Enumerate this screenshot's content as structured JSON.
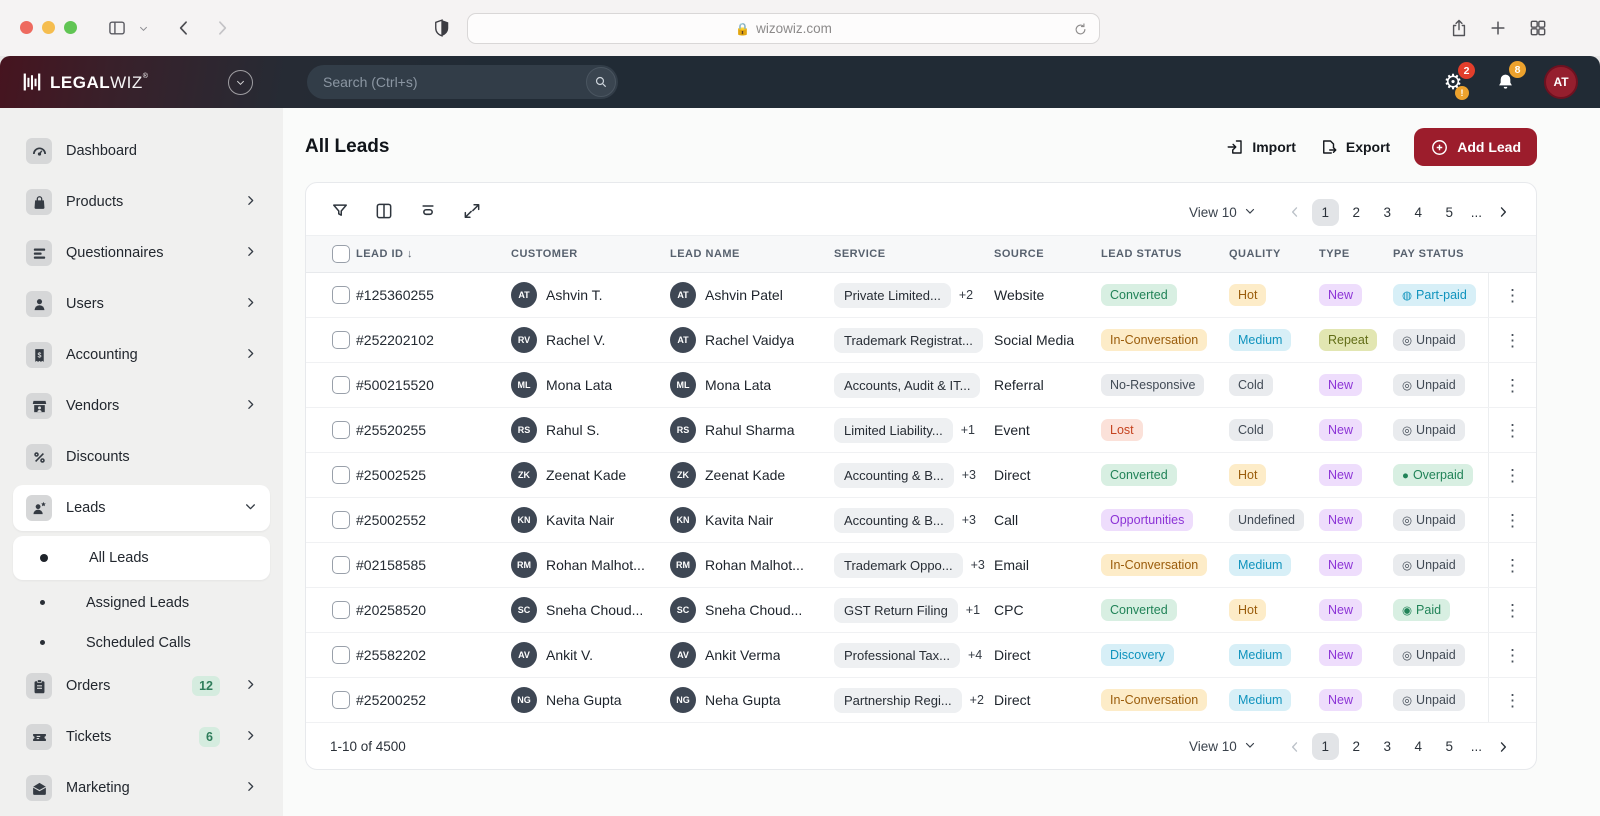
{
  "browser": {
    "url": "wizowiz.com"
  },
  "appbar": {
    "logo_bold": "LEGAL",
    "logo_light": "WIZ",
    "logo_reg": "®",
    "search_placeholder": "Search (Ctrl+s)",
    "settings_badge": "2",
    "settings_alert": "!",
    "notifications_badge": "8",
    "avatar_initials": "AT"
  },
  "sidebar": {
    "items": [
      {
        "icon": "dashboard",
        "label": "Dashboard"
      },
      {
        "icon": "products",
        "label": "Products",
        "chevron": "right"
      },
      {
        "icon": "questionnaires",
        "label": "Questionnaires",
        "chevron": "right"
      },
      {
        "icon": "users",
        "label": "Users",
        "chevron": "right"
      },
      {
        "icon": "accounting",
        "label": "Accounting",
        "chevron": "right"
      },
      {
        "icon": "vendors",
        "label": "Vendors",
        "chevron": "right"
      },
      {
        "icon": "discounts",
        "label": "Discounts"
      },
      {
        "icon": "leads",
        "label": "Leads",
        "chevron": "down",
        "active": true
      },
      {
        "label": "All Leads",
        "child": true,
        "active": true
      },
      {
        "label": "Assigned Leads",
        "child": true
      },
      {
        "label": "Scheduled Calls",
        "child": true
      },
      {
        "icon": "orders",
        "label": "Orders",
        "badge": "12",
        "chevron": "right"
      },
      {
        "icon": "tickets",
        "label": "Tickets",
        "badge": "6",
        "chevron": "right"
      },
      {
        "icon": "marketing",
        "label": "Marketing",
        "chevron": "right"
      }
    ]
  },
  "page": {
    "title": "All Leads",
    "import_label": "Import",
    "export_label": "Export",
    "add_lead_label": "Add Lead",
    "accent_color": "#9c1d2c"
  },
  "table": {
    "headers": [
      "LEAD ID",
      "CUSTOMER",
      "LEAD NAME",
      "SERVICE",
      "SOURCE",
      "LEAD STATUS",
      "QUALITY",
      "TYPE",
      "PAY STATUS"
    ],
    "sort_column": "LEAD ID",
    "sort_direction": "desc",
    "rows": [
      {
        "id": "#125360255",
        "customer": {
          "initials": "AT",
          "name": "Ashvin T."
        },
        "lead": {
          "initials": "AT",
          "name": "Ashvin Patel"
        },
        "service": {
          "label": "Private Limited...",
          "extra": "+2"
        },
        "source": "Website",
        "status": {
          "label": "Converted",
          "type": "green"
        },
        "quality": {
          "label": "Hot",
          "type": "amber"
        },
        "leadtype": {
          "label": "New",
          "type": "purple"
        },
        "pay": {
          "label": "Part-paid",
          "type": "cyan",
          "icon": "◍"
        }
      },
      {
        "id": "#252202102",
        "customer": {
          "initials": "RV",
          "name": "Rachel V."
        },
        "lead": {
          "initials": "AT",
          "name": "Rachel Vaidya"
        },
        "service": {
          "label": "Trademark Registrat...",
          "extra": ""
        },
        "source": "Social Media",
        "status": {
          "label": "In-Conversation",
          "type": "amber"
        },
        "quality": {
          "label": "Medium",
          "type": "cyan"
        },
        "leadtype": {
          "label": "Repeat",
          "type": "olive"
        },
        "pay": {
          "label": "Unpaid",
          "type": "gray",
          "icon": "◎"
        }
      },
      {
        "id": "#500215520",
        "customer": {
          "initials": "ML",
          "name": "Mona Lata"
        },
        "lead": {
          "initials": "ML",
          "name": "Mona Lata"
        },
        "service": {
          "label": "Accounts, Audit & IT...",
          "extra": ""
        },
        "source": "Referral",
        "status": {
          "label": "No-Responsive",
          "type": "gray"
        },
        "quality": {
          "label": "Cold",
          "type": "gray"
        },
        "leadtype": {
          "label": "New",
          "type": "purple"
        },
        "pay": {
          "label": "Unpaid",
          "type": "gray",
          "icon": "◎"
        }
      },
      {
        "id": "#25520255",
        "customer": {
          "initials": "RS",
          "name": "Rahul S."
        },
        "lead": {
          "initials": "RS",
          "name": "Rahul Sharma"
        },
        "service": {
          "label": "Limited Liability...",
          "extra": "+1"
        },
        "source": "Event",
        "status": {
          "label": "Lost",
          "type": "red"
        },
        "quality": {
          "label": "Cold",
          "type": "gray"
        },
        "leadtype": {
          "label": "New",
          "type": "purple"
        },
        "pay": {
          "label": "Unpaid",
          "type": "gray",
          "icon": "◎"
        }
      },
      {
        "id": "#25002525",
        "customer": {
          "initials": "ZK",
          "name": "Zeenat Kade"
        },
        "lead": {
          "initials": "ZK",
          "name": "Zeenat Kade"
        },
        "service": {
          "label": "Accounting & B...",
          "extra": "+3"
        },
        "source": "Direct",
        "status": {
          "label": "Converted",
          "type": "green"
        },
        "quality": {
          "label": "Hot",
          "type": "amber"
        },
        "leadtype": {
          "label": "New",
          "type": "purple"
        },
        "pay": {
          "label": "Overpaid",
          "type": "green",
          "icon": "●"
        }
      },
      {
        "id": "#25002552",
        "customer": {
          "initials": "KN",
          "name": "Kavita Nair"
        },
        "lead": {
          "initials": "KN",
          "name": "Kavita Nair"
        },
        "service": {
          "label": "Accounting & B...",
          "extra": "+3"
        },
        "source": "Call",
        "status": {
          "label": "Opportunities",
          "type": "purple"
        },
        "quality": {
          "label": "Undefined",
          "type": "gray"
        },
        "leadtype": {
          "label": "New",
          "type": "purple"
        },
        "pay": {
          "label": "Unpaid",
          "type": "gray",
          "icon": "◎"
        }
      },
      {
        "id": "#02158585",
        "customer": {
          "initials": "RM",
          "name": "Rohan Malhot..."
        },
        "lead": {
          "initials": "RM",
          "name": "Rohan Malhot..."
        },
        "service": {
          "label": "Trademark Oppo...",
          "extra": "+3"
        },
        "source": "Email",
        "status": {
          "label": "In-Conversation",
          "type": "amber"
        },
        "quality": {
          "label": "Medium",
          "type": "cyan"
        },
        "leadtype": {
          "label": "New",
          "type": "purple"
        },
        "pay": {
          "label": "Unpaid",
          "type": "gray",
          "icon": "◎"
        }
      },
      {
        "id": "#20258520",
        "customer": {
          "initials": "SC",
          "name": "Sneha Choud..."
        },
        "lead": {
          "initials": "SC",
          "name": "Sneha Choud..."
        },
        "service": {
          "label": "GST Return Filing",
          "extra": "+1"
        },
        "source": "CPC",
        "status": {
          "label": "Converted",
          "type": "green"
        },
        "quality": {
          "label": "Hot",
          "type": "amber"
        },
        "leadtype": {
          "label": "New",
          "type": "purple"
        },
        "pay": {
          "label": "Paid",
          "type": "green",
          "icon": "◉"
        }
      },
      {
        "id": "#25582202",
        "customer": {
          "initials": "AV",
          "name": "Ankit V."
        },
        "lead": {
          "initials": "AV",
          "name": "Ankit Verma"
        },
        "service": {
          "label": "Professional Tax...",
          "extra": "+4"
        },
        "source": "Direct",
        "status": {
          "label": "Discovery",
          "type": "cyan"
        },
        "quality": {
          "label": "Medium",
          "type": "cyan"
        },
        "leadtype": {
          "label": "New",
          "type": "purple"
        },
        "pay": {
          "label": "Unpaid",
          "type": "gray",
          "icon": "◎"
        }
      },
      {
        "id": "#25200252",
        "customer": {
          "initials": "NG",
          "name": "Neha Gupta"
        },
        "lead": {
          "initials": "NG",
          "name": "Neha Gupta"
        },
        "service": {
          "label": "Partnership Regi...",
          "extra": "+2"
        },
        "source": "Direct",
        "status": {
          "label": "In-Conversation",
          "type": "amber"
        },
        "quality": {
          "label": "Medium",
          "type": "cyan"
        },
        "leadtype": {
          "label": "New",
          "type": "purple"
        },
        "pay": {
          "label": "Unpaid",
          "type": "gray",
          "icon": "◎"
        }
      }
    ]
  },
  "pagination": {
    "view_label": "View 10",
    "pages": [
      "1",
      "2",
      "3",
      "4",
      "5"
    ],
    "current_page": "1",
    "ellipsis": "...",
    "summary": "1-10 of 4500"
  }
}
